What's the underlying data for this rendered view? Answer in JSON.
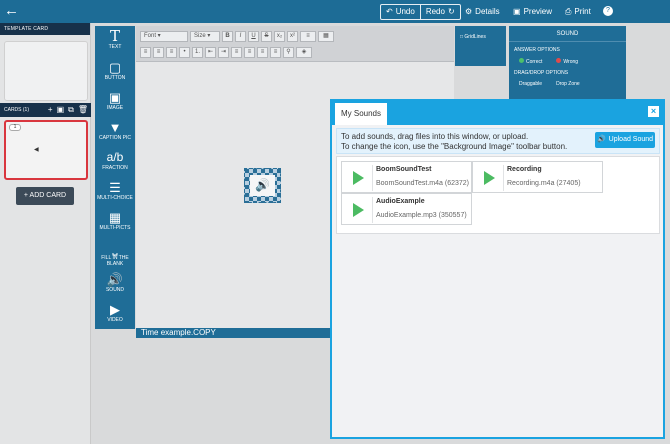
{
  "topbar": {
    "undo": "Undo",
    "redo": "Redo",
    "details": "Details",
    "preview": "Preview",
    "print": "Print",
    "help": "?"
  },
  "left": {
    "template_card": "TEMPLATE CARD",
    "cards": "CARDS (1)",
    "card_number": "1",
    "add_card": "+ ADD CARD"
  },
  "tools": [
    {
      "label": "TEXT",
      "icon": "text-icon"
    },
    {
      "label": "BUTTON",
      "icon": "button-icon"
    },
    {
      "label": "IMAGE",
      "icon": "image-icon"
    },
    {
      "label": "CAPTION PIC",
      "icon": "tag-icon"
    },
    {
      "label": "FRACTION",
      "icon": "fraction-icon"
    },
    {
      "label": "MULTI-CHOICE",
      "icon": "list-icon"
    },
    {
      "label": "MULTI-PICTS",
      "icon": "grid-icon"
    },
    {
      "label": "FILL IN THE BLANK",
      "icon": "blank-icon"
    },
    {
      "label": "SOUND",
      "icon": "speaker-icon"
    },
    {
      "label": "VIDEO",
      "icon": "video-icon"
    }
  ],
  "format": {
    "font": "Font",
    "size": "Size"
  },
  "editor": {
    "caption": "Time example.COPY"
  },
  "gridlines": "GridLines",
  "sound_panel": {
    "title": "SOUND",
    "answer_options": "ANSWER OPTIONS",
    "correct": "Correct",
    "wrong": "Wrong",
    "drag_drop": "DRAG/DROP OPTIONS",
    "draggable": "Draggable",
    "drop_zone": "Drop Zone"
  },
  "dialog": {
    "tab": "My Sounds",
    "close": "×",
    "instruction_1": "To add sounds, drag files into this window, or upload.",
    "instruction_2": "To change the icon, use the \"Background Image\" toolbar button.",
    "upload": "Upload Sound",
    "sounds": [
      {
        "name": "BoomSoundTest",
        "meta": "BoomSoundTest.m4a (62372)"
      },
      {
        "name": "Recording",
        "meta": "Recording.m4a (27405)"
      },
      {
        "name": "AudioExample",
        "meta": "AudioExample.mp3 (350557)"
      }
    ]
  },
  "colors": {
    "toolbar_blue": "#1d6c96",
    "dialog_accent": "#1aa3e0",
    "play_green": "#4cbb62",
    "selected_card_red": "#d9363e"
  }
}
